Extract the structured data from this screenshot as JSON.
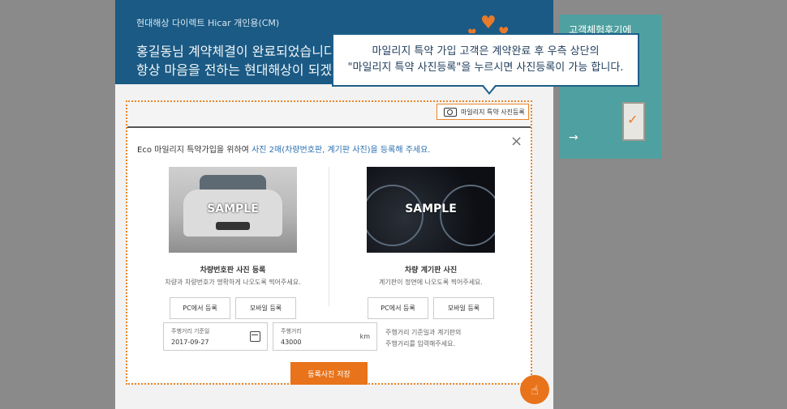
{
  "hero": {
    "brand": "현대해상 다이렉트  Hicar 개인용(CM)",
    "line1": "홍길동님 계약체결이 완료되었습니다.",
    "line2": "항상 마음을 전하는 현대해상이 되겠습"
  },
  "side_banner": {
    "title": "고객체험후기에",
    "arrow": "→"
  },
  "tooltip": {
    "line1": "마일리지 특약 가입 고객은 계약완료 후 우측 상단의",
    "line2": "\"마일리지 특약 사진등록\"을 누르시면 사진등록이 가능 합니다."
  },
  "photo_register_button": {
    "label": "마일리지 특약 사진등록",
    "icon": "camera-icon"
  },
  "modal": {
    "title_prefix": "Eco 마일리지 특약가입을 위하여 ",
    "title_highlight": "사진 2매(차량번호판, 계기판 사진)을 등록해 주세요.",
    "close_icon": "×",
    "highlight_color": "#2a6fb0",
    "plate": {
      "sample": "SAMPLE",
      "heading": "차량번호판 사진 등록",
      "desc": "차량과 차량번호가 명확하게 나오도록 찍어주세요.",
      "pc_button": "PC에서 등록",
      "mobile_button": "모바일 등록"
    },
    "dashboard": {
      "sample": "SAMPLE",
      "heading": "차량 계기판 사진",
      "desc": "계기판이 정면에 나오도록 찍어주세요.",
      "pc_button": "PC에서 등록",
      "mobile_button": "모바일 등록"
    },
    "date_field": {
      "label": "주행거리 기준일",
      "value": "2017-09-27",
      "icon": "calendar-icon"
    },
    "mileage_field": {
      "label": "주행거리",
      "value": "43000",
      "unit": "km"
    },
    "note_line1": "주행거리 기준일과 계기판의",
    "note_line2": "주행거리를 입력해주세요.",
    "save_button": "등록사진 저장"
  },
  "fab": {
    "icon": "hand-pointer-icon",
    "glyph": "☝"
  },
  "colors": {
    "accent": "#e8731a",
    "hero_bg": "#1a5a84",
    "side_bg": "#4fa0a0"
  }
}
